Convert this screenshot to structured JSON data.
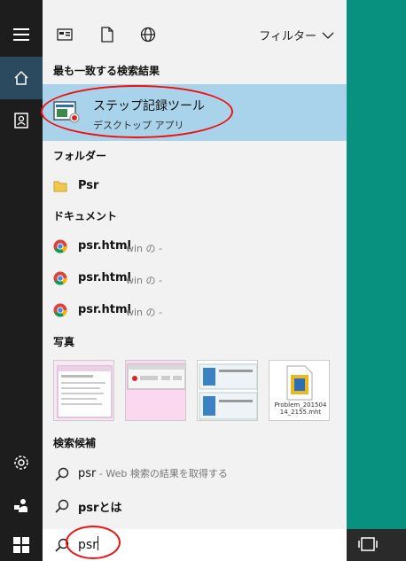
{
  "filter_label": "フィルター",
  "sections": {
    "best_match": "最も一致する検索結果",
    "folders": "フォルダー",
    "documents": "ドキュメント",
    "photos": "写真",
    "suggestions": "検索候補"
  },
  "best": {
    "title": "ステップ記録ツール",
    "subtitle": "デスクトップ アプリ"
  },
  "folder_item": "Psr",
  "documents": [
    {
      "name": "psr.html",
      "meta": "win の -"
    },
    {
      "name": "psr.html",
      "meta": "win の -"
    },
    {
      "name": "psr.html",
      "meta": "win の -"
    }
  ],
  "photo4_caption": "Problem_20150414_2155.mht",
  "suggestion1": {
    "text": "psr",
    "hint": " - Web 検索の結果を取得する"
  },
  "suggestion2": {
    "text": "psrとは"
  },
  "query": "psr",
  "colors": {
    "selection": "#a9d3ea",
    "rail": "#1d1d1d",
    "desktop": "#08917f",
    "highlight": "#ee1111"
  }
}
